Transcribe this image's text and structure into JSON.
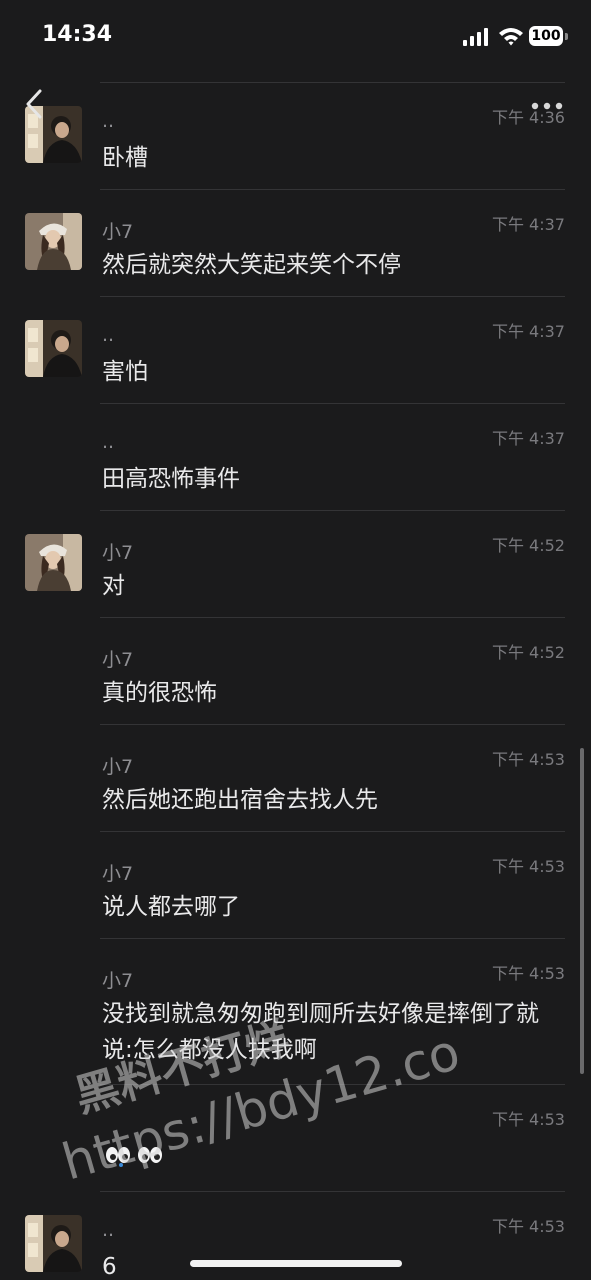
{
  "status_bar": {
    "time": "14:34",
    "battery": "100"
  },
  "icons": {
    "back": "chevron-left-icon",
    "more": "more-dots-icon",
    "signal": "cellular-signal-icon",
    "wifi": "wifi-icon",
    "battery": "battery-icon"
  },
  "messages": [
    {
      "sender": "..",
      "time": "下午 4:36",
      "text": "卧槽",
      "avatar": "avatar-dotdot"
    },
    {
      "sender": "小7",
      "time": "下午 4:37",
      "text": "然后就突然大笑起来笑个不停",
      "avatar": "avatar-xiao7"
    },
    {
      "sender": "..",
      "time": "下午 4:37",
      "text": "害怕",
      "avatar": "avatar-dotdot"
    },
    {
      "sender": "..",
      "time": "下午 4:37",
      "text": "田高恐怖事件",
      "avatar": ""
    },
    {
      "sender": "小7",
      "time": "下午 4:52",
      "text": "对",
      "avatar": "avatar-xiao7"
    },
    {
      "sender": "小7",
      "time": "下午 4:52",
      "text": "真的很恐怖",
      "avatar": ""
    },
    {
      "sender": "小7",
      "time": "下午 4:53",
      "text": "然后她还跑出宿舍去找人先",
      "avatar": ""
    },
    {
      "sender": "小7",
      "time": "下午 4:53",
      "text": "说人都去哪了",
      "avatar": ""
    },
    {
      "sender": "小7",
      "time": "下午 4:53",
      "text": "没找到就急匆匆跑到厕所去好像是摔倒了就说:怎么都没人扶我啊",
      "avatar": ""
    },
    {
      "sender": "",
      "time": "下午 4:53",
      "text": "",
      "avatar": ""
    },
    {
      "sender": "..",
      "time": "下午 4:53",
      "text": "6",
      "avatar": "avatar-dotdot"
    }
  ],
  "watermark": {
    "line1": "黑料不打烊",
    "line2": "https://bdy12.co"
  },
  "colors": {
    "background": "#1b1b1c",
    "divider": "#343436",
    "text": "#e9e9ea",
    "meta": "#8e8e92"
  }
}
